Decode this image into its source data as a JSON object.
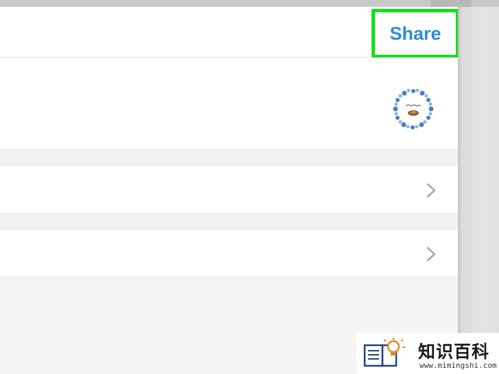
{
  "navbar": {
    "share_label": "Share"
  },
  "profile": {
    "avatar_icon": "wreath-nest-avatar-icon",
    "avatar_text": "the birds nest"
  },
  "rows": [
    {
      "chevron_icon": "chevron-right-icon"
    },
    {
      "chevron_icon": "chevron-right-icon"
    }
  ],
  "watermark": {
    "brand": "知识百科",
    "url": "www.mimingshi.com"
  },
  "colors": {
    "accent": "#2f8bd8",
    "highlight": "#14e01c"
  }
}
